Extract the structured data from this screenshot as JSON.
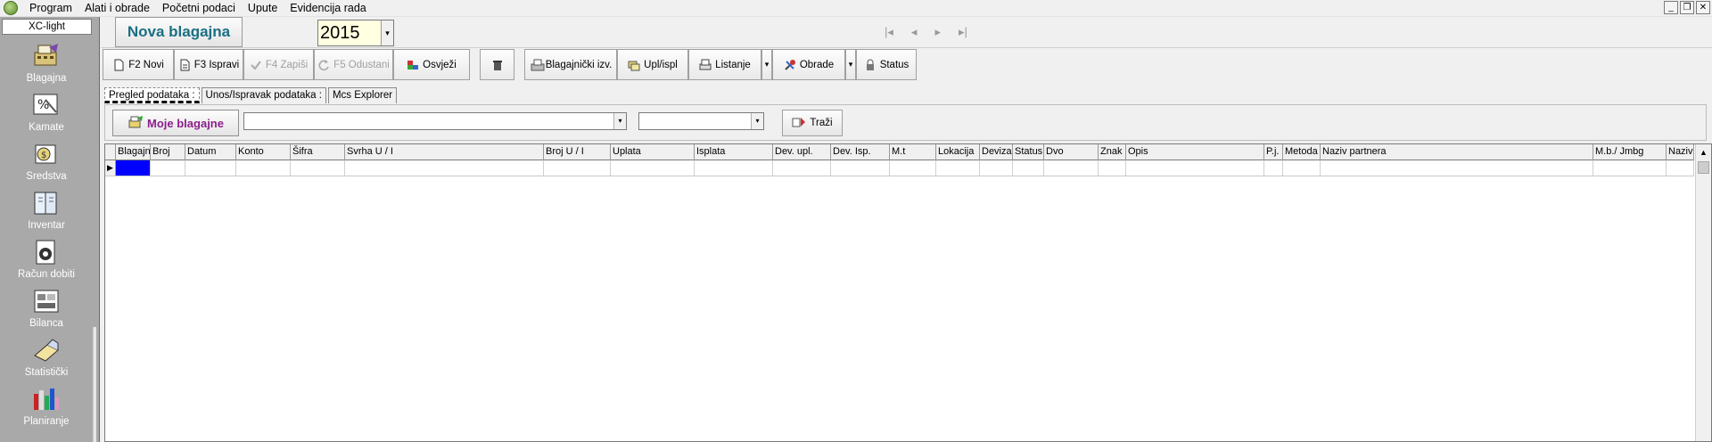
{
  "menu": {
    "items": [
      "Program",
      "Alati i obrade",
      "Početni podaci",
      "Upute",
      "Evidencija rada"
    ],
    "window_controls": [
      "_",
      "❐",
      "✕"
    ]
  },
  "sidebar": {
    "title": "XC-light",
    "items": [
      {
        "label": "Blagajna",
        "icon": "cash-register-icon"
      },
      {
        "label": "Kamate",
        "icon": "interest-icon"
      },
      {
        "label": "Sredstva",
        "icon": "assets-icon"
      },
      {
        "label": "Inventar",
        "icon": "inventory-icon"
      },
      {
        "label": "Račun dobiti",
        "icon": "profit-account-icon"
      },
      {
        "label": "Bilanca",
        "icon": "balance-icon"
      },
      {
        "label": "Statistički",
        "icon": "statistics-icon"
      },
      {
        "label": "Planiranje",
        "icon": "planning-icon"
      }
    ]
  },
  "header": {
    "title": "Nova blagajna",
    "year": "2015",
    "nav": [
      "|◂",
      "◂",
      "▸",
      "▸|"
    ]
  },
  "toolbar": {
    "new_label": "F2 Novi",
    "edit_label": "F3 Ispravi",
    "save_label": "F4 Zapiši",
    "cancel_label": "F5 Odustani",
    "refresh_label": "Osvježi",
    "report_label": "Blagajnički izv.",
    "inout_label": "Upl/ispl",
    "list_label": "Listanje",
    "process_label": "Obrade",
    "status_label": "Status",
    "dropdown_glyph": "▾"
  },
  "tabs": [
    {
      "label": "Pregled podataka :",
      "active": true
    },
    {
      "label": "Unos/Ispravak podataka :",
      "active": false
    },
    {
      "label": "Mcs Explorer",
      "active": false
    }
  ],
  "filter": {
    "moje_label": "Moje blagajne",
    "combo1_value": "",
    "combo2_value": "",
    "search_label": "Traži",
    "dropdown_glyph": "▾"
  },
  "grid": {
    "columns": [
      "Blagajna",
      "Broj",
      "Datum",
      "Konto",
      "Šifra",
      "Svrha U / I",
      "Broj U / I",
      "Uplata",
      "Isplata",
      "Dev. upl.",
      "Dev. Isp.",
      "M.t",
      "Lokacija",
      "Deviza",
      "Status",
      "Dvo",
      "Znak",
      "Opis",
      "P.j.",
      "Metoda",
      "Naziv partnera",
      "M.b./ Jmbg",
      "Naziv"
    ],
    "row_indicator": "▶",
    "scroll_up": "▲"
  }
}
